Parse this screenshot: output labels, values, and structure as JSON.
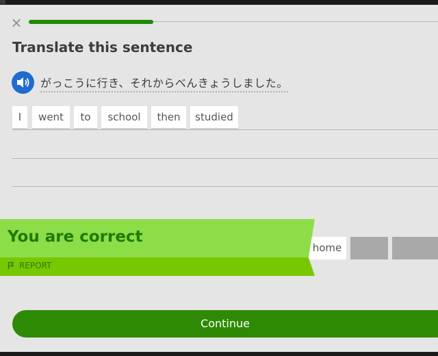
{
  "header": {
    "close_icon": "×",
    "progress_fraction": 0.305
  },
  "heading": "Translate this sentence",
  "prompt": {
    "audio_icon": "speaker-icon",
    "sentence": "がっこうに行き、それからべんきょうしました。"
  },
  "answer_chips": [
    "I",
    "went",
    "to",
    "school",
    "then",
    "studied"
  ],
  "word_bank": {
    "visible_word": "home"
  },
  "feedback": {
    "message": "You are correct",
    "report_label": "REPORT"
  },
  "continue_label": "Continue",
  "colors": {
    "progress": "#1f8a06",
    "speaker": "#1f6bd0",
    "banner_top": "#8ddd48",
    "banner_bottom": "#78c801",
    "correct_text": "#1f7a06",
    "continue_button": "#2e8a05"
  }
}
